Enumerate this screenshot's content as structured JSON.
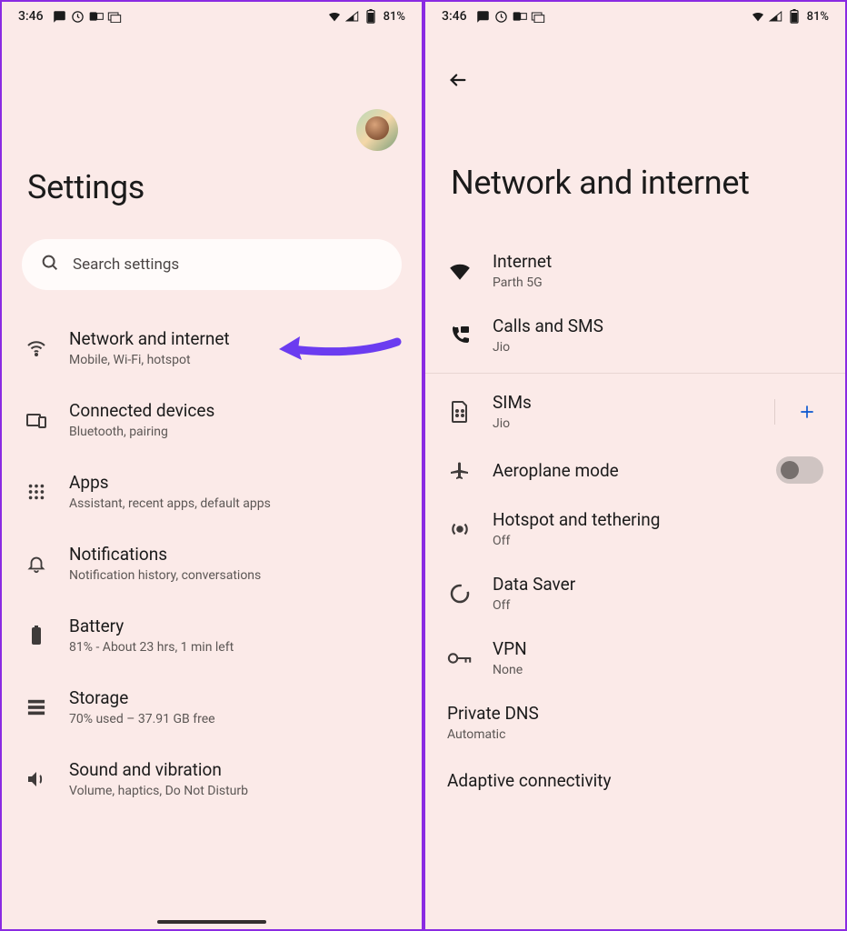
{
  "status": {
    "time": "3:46",
    "battery": "81%"
  },
  "left": {
    "title": "Settings",
    "search_placeholder": "Search settings",
    "items": [
      {
        "title": "Network and internet",
        "sub": "Mobile, Wi-Fi, hotspot"
      },
      {
        "title": "Connected devices",
        "sub": "Bluetooth, pairing"
      },
      {
        "title": "Apps",
        "sub": "Assistant, recent apps, default apps"
      },
      {
        "title": "Notifications",
        "sub": "Notification history, conversations"
      },
      {
        "title": "Battery",
        "sub": "81% - About 23 hrs, 1 min left"
      },
      {
        "title": "Storage",
        "sub": "70% used – 37.91 GB free"
      },
      {
        "title": "Sound and vibration",
        "sub": "Volume, haptics, Do Not Disturb"
      }
    ]
  },
  "right": {
    "title": "Network and internet",
    "items": [
      {
        "title": "Internet",
        "sub": "Parth 5G"
      },
      {
        "title": "Calls and SMS",
        "sub": "Jio"
      },
      {
        "title": "SIMs",
        "sub": "Jio"
      },
      {
        "title": "Aeroplane mode",
        "sub": ""
      },
      {
        "title": "Hotspot and tethering",
        "sub": "Off"
      },
      {
        "title": "Data Saver",
        "sub": "Off"
      },
      {
        "title": "VPN",
        "sub": "None"
      },
      {
        "title": "Private DNS",
        "sub": "Automatic"
      },
      {
        "title": "Adaptive connectivity",
        "sub": ""
      }
    ]
  }
}
